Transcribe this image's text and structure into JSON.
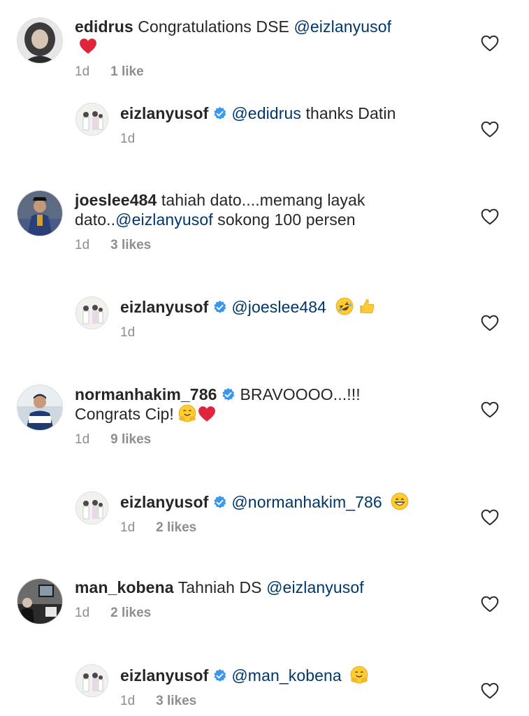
{
  "colors": {
    "text": "#262626",
    "mention": "#00376b",
    "meta": "#8e8e8e",
    "verified": "#3897f0",
    "heart_red": "#ed4956"
  },
  "comments": [
    {
      "username": "edidrus",
      "text": "Congratulations DSE",
      "mention": "@eizlanyusof",
      "trailing_emoji": "red-heart",
      "time": "1d",
      "likes": "1 like"
    },
    {
      "username": "eizlanyusof",
      "verified": true,
      "mention": "@edidrus",
      "text": "thanks Datin",
      "time": "1d",
      "likes": ""
    },
    {
      "username": "joeslee484",
      "text_line1": "tahiah dato....memang layak",
      "text_line2_prefix": "dato..",
      "mention": "@eizlanyusof",
      "text_line2_suffix": "sokong 100 persen",
      "time": "1d",
      "likes": "3 likes"
    },
    {
      "username": "eizlanyusof",
      "verified": true,
      "mention": "@joeslee484",
      "emojis": [
        "rolling-laughing",
        "thumbs-up"
      ],
      "time": "1d",
      "likes": ""
    },
    {
      "username": "normanhakim_786",
      "verified": true,
      "text_line1": "BRAVOOOO...!!!",
      "text_line2": "Congrats Cip!",
      "emojis": [
        "hugging-face",
        "red-heart"
      ],
      "time": "1d",
      "likes": "9 likes"
    },
    {
      "username": "eizlanyusof",
      "verified": true,
      "mention": "@normanhakim_786",
      "emojis": [
        "grinning-face"
      ],
      "time": "1d",
      "likes": "2 likes"
    },
    {
      "username": "man_kobena",
      "text": "Tahniah DS",
      "mention": "@eizlanyusof",
      "time": "1d",
      "likes": "2 likes"
    },
    {
      "username": "eizlanyusof",
      "verified": true,
      "mention": "@man_kobena",
      "emojis": [
        "hugging-face"
      ],
      "time": "1d",
      "likes": "3 likes"
    }
  ]
}
